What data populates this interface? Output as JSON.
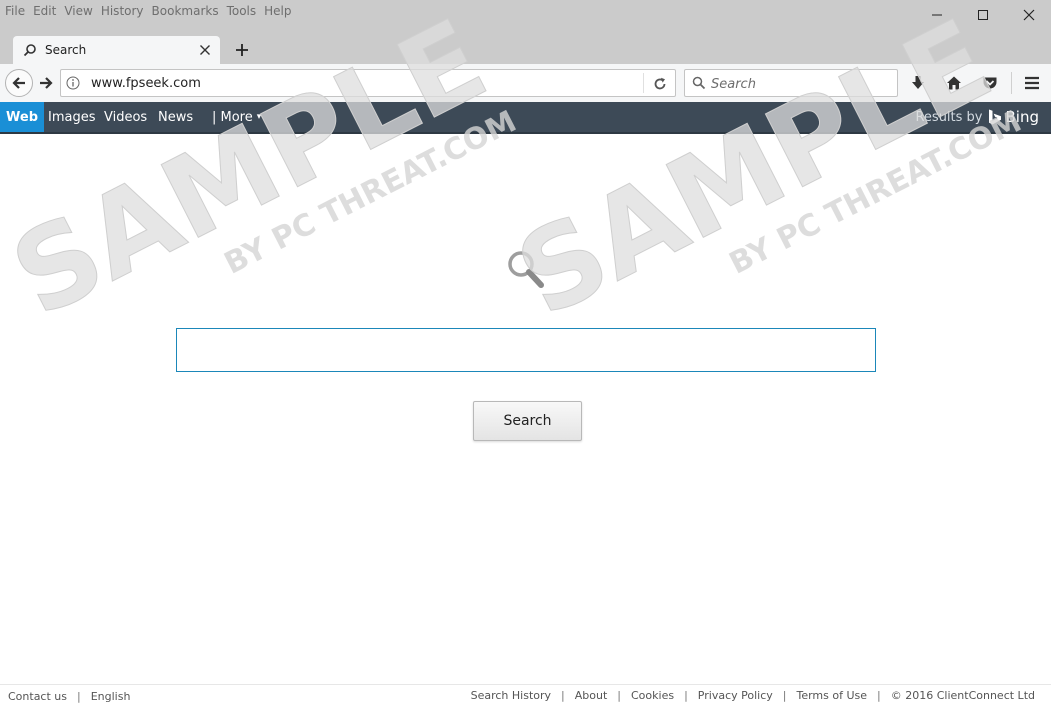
{
  "menu": [
    "File",
    "Edit",
    "View",
    "History",
    "Bookmarks",
    "Tools",
    "Help"
  ],
  "tab": {
    "title": "Search",
    "new_tab_label": "+"
  },
  "navbar": {
    "url": "www.fpseek.com",
    "search_placeholder": "Search"
  },
  "site_nav": {
    "items": [
      "Web",
      "Images",
      "Videos",
      "News",
      "| More"
    ],
    "more_arrow": "▾",
    "results_by": "Results by",
    "bing": "Bing"
  },
  "main": {
    "search_value": "",
    "search_button": "Search"
  },
  "watermark": {
    "main": "SAMPLE",
    "sub": "BY PC THREAT.COM"
  },
  "footer": {
    "left": [
      "Contact us",
      "English"
    ],
    "right": [
      "Search History",
      "About",
      "Cookies",
      "Privacy Policy",
      "Terms of Use",
      "© 2016 ClientConnect Ltd"
    ],
    "separator": "|"
  },
  "colors": {
    "web_tab": "#1a8fd6",
    "site_nav_bg": "#3d4a57",
    "search_border": "#1b87b9"
  }
}
